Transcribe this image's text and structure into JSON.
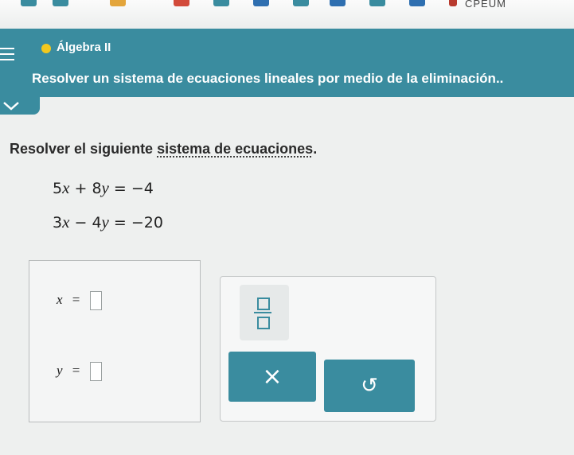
{
  "toolbar": {
    "label": "CPEUM"
  },
  "header": {
    "course": "Álgebra II",
    "topic": "Resolver un sistema de ecuaciones lineales por medio de la eliminación.."
  },
  "problem": {
    "instruction_prefix": "Resolver el siguiente ",
    "instruction_link": "sistema de ecuaciones",
    "instruction_suffix": ".",
    "equations": [
      {
        "a": "5",
        "b": "8",
        "op": "+",
        "rhs": "−4"
      },
      {
        "a": "3",
        "b": "4",
        "op": "−",
        "rhs": "−20"
      }
    ]
  },
  "answer": {
    "x_label": "x",
    "y_label": "y",
    "equals": "=",
    "x_value": "",
    "y_value": ""
  },
  "keypad": {
    "clear_symbol": "×",
    "undo_symbol": "↺"
  },
  "colors": {
    "accent": "#3a8c9f",
    "status_dot": "#f2c81e",
    "background": "#eef0ef"
  }
}
